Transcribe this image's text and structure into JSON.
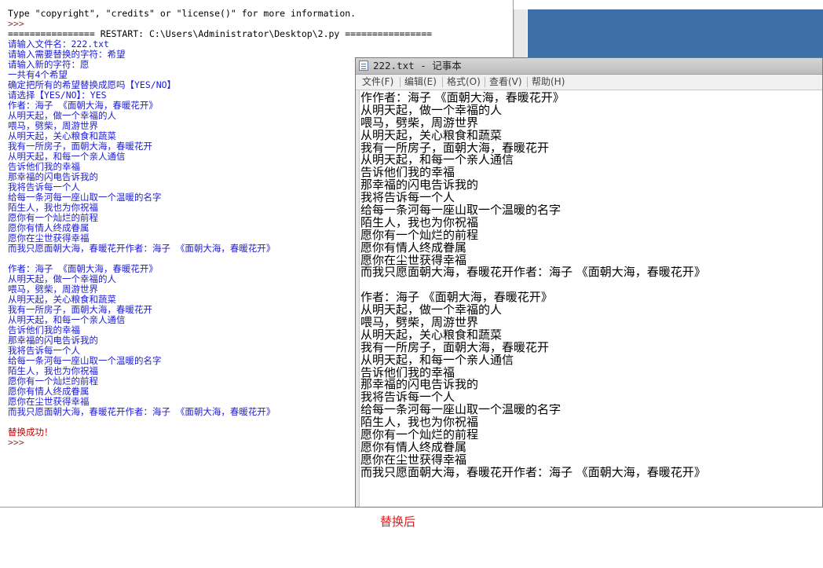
{
  "shell": {
    "lines": [
      {
        "text": "Type \"copyright\", \"credits\" or \"license()\" for more information.",
        "color": "black"
      },
      {
        "text": ">>> ",
        "color": "brown"
      },
      {
        "text": "================ RESTART: C:\\Users\\Administrator\\Desktop\\2.py ================",
        "color": "black"
      },
      {
        "text": "请输入文件名：222.txt",
        "color": "blue"
      },
      {
        "text": "请输入需要替换的字符：希望",
        "color": "blue"
      },
      {
        "text": "请输入新的字符：愿",
        "color": "blue"
      },
      {
        "text": "一共有4个希望",
        "color": "blue"
      },
      {
        "text": "确定把所有的希望替换成愿吗【YES/NO】",
        "color": "blue"
      },
      {
        "text": "请选择【YES/NO】：YES",
        "color": "blue"
      },
      {
        "text": "作者：海子 《面朝大海，春暖花开》",
        "color": "blue"
      },
      {
        "text": "从明天起，做一个幸福的人",
        "color": "blue"
      },
      {
        "text": "喂马，劈柴，周游世界",
        "color": "blue"
      },
      {
        "text": "从明天起，关心粮食和蔬菜",
        "color": "blue"
      },
      {
        "text": "我有一所房子，面朝大海，春暖花开",
        "color": "blue"
      },
      {
        "text": "从明天起，和每一个亲人通信",
        "color": "blue"
      },
      {
        "text": "告诉他们我的幸福",
        "color": "blue"
      },
      {
        "text": "那幸福的闪电告诉我的",
        "color": "blue"
      },
      {
        "text": "我将告诉每一个人",
        "color": "blue"
      },
      {
        "text": "给每一条河每一座山取一个温暖的名字",
        "color": "blue"
      },
      {
        "text": "陌生人，我也为你祝福",
        "color": "blue"
      },
      {
        "text": "愿你有一个灿烂的前程",
        "color": "blue"
      },
      {
        "text": "愿你有情人终成眷属",
        "color": "blue"
      },
      {
        "text": "愿你在尘世获得幸福",
        "color": "blue"
      },
      {
        "text": "而我只愿面朝大海，春暖花开作者：海子 《面朝大海，春暖花开》",
        "color": "blue"
      },
      {
        "text": "",
        "color": "blue"
      },
      {
        "text": "作者：海子 《面朝大海，春暖花开》",
        "color": "blue"
      },
      {
        "text": "从明天起，做一个幸福的人",
        "color": "blue"
      },
      {
        "text": "喂马，劈柴，周游世界",
        "color": "blue"
      },
      {
        "text": "从明天起，关心粮食和蔬菜",
        "color": "blue"
      },
      {
        "text": "我有一所房子，面朝大海，春暖花开",
        "color": "blue"
      },
      {
        "text": "从明天起，和每一个亲人通信",
        "color": "blue"
      },
      {
        "text": "告诉他们我的幸福",
        "color": "blue"
      },
      {
        "text": "那幸福的闪电告诉我的",
        "color": "blue"
      },
      {
        "text": "我将告诉每一个人",
        "color": "blue"
      },
      {
        "text": "给每一条河每一座山取一个温暖的名字",
        "color": "blue"
      },
      {
        "text": "陌生人，我也为你祝福",
        "color": "blue"
      },
      {
        "text": "愿你有一个灿烂的前程",
        "color": "blue"
      },
      {
        "text": "愿你有情人终成眷属",
        "color": "blue"
      },
      {
        "text": "愿你在尘世获得幸福",
        "color": "blue"
      },
      {
        "text": "而我只愿面朝大海，春暖花开作者：海子 《面朝大海，春暖花开》",
        "color": "blue"
      },
      {
        "text": "",
        "color": "blue"
      },
      {
        "text": "替换成功！",
        "color": "red"
      },
      {
        "text": ">>> ",
        "color": "brown"
      }
    ]
  },
  "notepad": {
    "title": "222.txt - 记事本",
    "menu": [
      "文件(F)",
      "编辑(E)",
      "格式(O)",
      "查看(V)",
      "帮助(H)"
    ],
    "lines": [
      "作作者：海子 《面朝大海，春暖花开》",
      "从明天起，做一个幸福的人",
      "喂马，劈柴，周游世界",
      "从明天起，关心粮食和蔬菜",
      "我有一所房子，面朝大海，春暖花开",
      "从明天起，和每一个亲人通信",
      "告诉他们我的幸福",
      "那幸福的闪电告诉我的",
      "我将告诉每一个人",
      "给每一条河每一座山取一个温暖的名字",
      "陌生人，我也为你祝福",
      "愿你有一个灿烂的前程",
      "愿你有情人终成眷属",
      "愿你在尘世获得幸福",
      "而我只愿面朝大海，春暖花开作者：海子 《面朝大海，春暖花开》",
      "",
      "作者：海子 《面朝大海，春暖花开》",
      "从明天起，做一个幸福的人",
      "喂马，劈柴，周游世界",
      "从明天起，关心粮食和蔬菜",
      "我有一所房子，面朝大海，春暖花开",
      "从明天起，和每一个亲人通信",
      "告诉他们我的幸福",
      "那幸福的闪电告诉我的",
      "我将告诉每一个人",
      "给每一条河每一座山取一个温暖的名字",
      "陌生人，我也为你祝福",
      "愿你有一个灿烂的前程",
      "愿你有情人终成眷属",
      "愿你在尘世获得幸福",
      "而我只愿面朝大海，春暖花开作者：海子 《面朝大海，春暖花开》"
    ]
  },
  "caption": "替换后",
  "colors": {
    "shell_output": "#1b1bd6",
    "shell_success": "#c00000",
    "caption": "#e02020",
    "background_window": "#3c6fa6"
  }
}
